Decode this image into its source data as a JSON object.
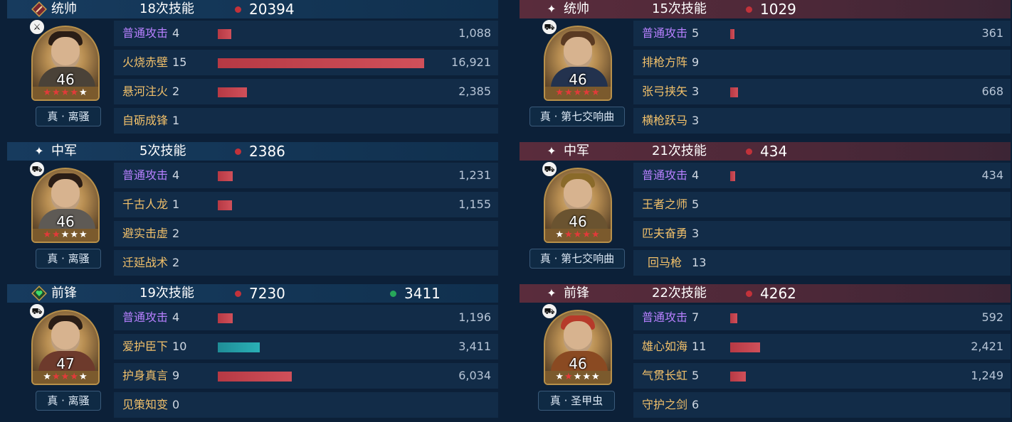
{
  "colors": {
    "panel_left": "#133555",
    "panel_right": "#4c2838",
    "row_bg": "#122c48",
    "damage_red": "#c64a52",
    "heal_green": "#27a75a",
    "heal_teal": "#2ab0b6",
    "normal_attack_purple": "#b780ff",
    "skill_gold": "#f1c06a"
  },
  "left_team": [
    {
      "role": "统帅",
      "role_icon": "sword-badge-icon",
      "skill_count": "18次技能",
      "damage_total": "20394",
      "heal_total": "",
      "level": "46",
      "stars": "★★★★★",
      "tag": "真 · 离骚",
      "skills": [
        {
          "name": "普通攻击",
          "count": "4",
          "value": "1,088",
          "ratio": 0.064,
          "type": "damage",
          "normal": true
        },
        {
          "name": "火烧赤壁",
          "count": "15",
          "value": "16,921",
          "ratio": 1.0,
          "type": "damage",
          "normal": false
        },
        {
          "name": "悬河注火",
          "count": "2",
          "value": "2,385",
          "ratio": 0.141,
          "type": "damage",
          "normal": false
        },
        {
          "name": "自砺成锋",
          "count": "1",
          "value": "",
          "ratio": 0,
          "type": "none",
          "normal": false
        }
      ]
    },
    {
      "role": "中军",
      "role_icon": "sparkle-icon",
      "skill_count": "5次技能",
      "damage_total": "2386",
      "heal_total": "",
      "level": "46",
      "stars": "★★★★★",
      "tag": "真 · 离骚",
      "skills": [
        {
          "name": "普通攻击",
          "count": "4",
          "value": "1,231",
          "ratio": 0.073,
          "type": "damage",
          "normal": true
        },
        {
          "name": "千古人龙",
          "count": "1",
          "value": "1,155",
          "ratio": 0.068,
          "type": "damage",
          "normal": false
        },
        {
          "name": "避实击虚",
          "count": "2",
          "value": "",
          "ratio": 0,
          "type": "none",
          "normal": false
        },
        {
          "name": "迁延战术",
          "count": "2",
          "value": "",
          "ratio": 0,
          "type": "none",
          "normal": false
        }
      ]
    },
    {
      "role": "前锋",
      "role_icon": "heart-badge-icon",
      "skill_count": "19次技能",
      "damage_total": "7230",
      "heal_total": "3411",
      "level": "47",
      "stars": "★★★★★",
      "tag": "真 · 离骚",
      "skills": [
        {
          "name": "普通攻击",
          "count": "4",
          "value": "1,196",
          "ratio": 0.071,
          "type": "damage",
          "normal": true
        },
        {
          "name": "爱护臣下",
          "count": "10",
          "value": "3,411",
          "ratio": 0.202,
          "type": "heal",
          "normal": false
        },
        {
          "name": "护身真言",
          "count": "9",
          "value": "6,034",
          "ratio": 0.357,
          "type": "damage",
          "normal": false
        },
        {
          "name": "见策知变",
          "count": "0",
          "value": "",
          "ratio": 0,
          "type": "none",
          "normal": false
        }
      ]
    }
  ],
  "right_team": [
    {
      "role": "统帅",
      "role_icon": "sparkle-icon",
      "skill_count": "15次技能",
      "damage_total": "1029",
      "heal_total": "",
      "level": "46",
      "stars": "★★★★★",
      "tag": "真 · 第七交响曲",
      "skills": [
        {
          "name": "普通攻击",
          "count": "5",
          "value": "361",
          "ratio": 0.021,
          "type": "damage",
          "normal": true
        },
        {
          "name": "排枪方阵",
          "count": "9",
          "value": "",
          "ratio": 0,
          "type": "none",
          "normal": false
        },
        {
          "name": "张弓挟矢",
          "count": "3",
          "value": "668",
          "ratio": 0.039,
          "type": "damage",
          "normal": false
        },
        {
          "name": "横枪跃马",
          "count": "3",
          "value": "",
          "ratio": 0,
          "type": "none",
          "normal": false
        }
      ]
    },
    {
      "role": "中军",
      "role_icon": "sparkle-icon",
      "skill_count": "21次技能",
      "damage_total": "434",
      "heal_total": "",
      "level": "46",
      "stars": "★★★★★",
      "tag": "真 · 第七交响曲",
      "skills": [
        {
          "name": "普通攻击",
          "count": "4",
          "value": "434",
          "ratio": 0.026,
          "type": "damage",
          "normal": true
        },
        {
          "name": "王者之师",
          "count": "5",
          "value": "",
          "ratio": 0,
          "type": "none",
          "normal": false
        },
        {
          "name": "匹夫奋勇",
          "count": "3",
          "value": "",
          "ratio": 0,
          "type": "none",
          "normal": false
        },
        {
          "name": "回马枪",
          "count": "13",
          "value": "",
          "ratio": 0,
          "type": "none",
          "normal": false
        }
      ]
    },
    {
      "role": "前锋",
      "role_icon": "sparkle-icon",
      "skill_count": "22次技能",
      "damage_total": "4262",
      "heal_total": "",
      "level": "46",
      "stars": "★★★★★",
      "tag": "真 · 圣甲虫",
      "skills": [
        {
          "name": "普通攻击",
          "count": "7",
          "value": "592",
          "ratio": 0.035,
          "type": "damage",
          "normal": true
        },
        {
          "name": "雄心如海",
          "count": "11",
          "value": "2,421",
          "ratio": 0.143,
          "type": "damage",
          "normal": false
        },
        {
          "name": "气贯长虹",
          "count": "5",
          "value": "1,249",
          "ratio": 0.074,
          "type": "damage",
          "normal": false
        },
        {
          "name": "守护之剑",
          "count": "6",
          "value": "",
          "ratio": 0,
          "type": "none",
          "normal": false
        }
      ]
    }
  ]
}
